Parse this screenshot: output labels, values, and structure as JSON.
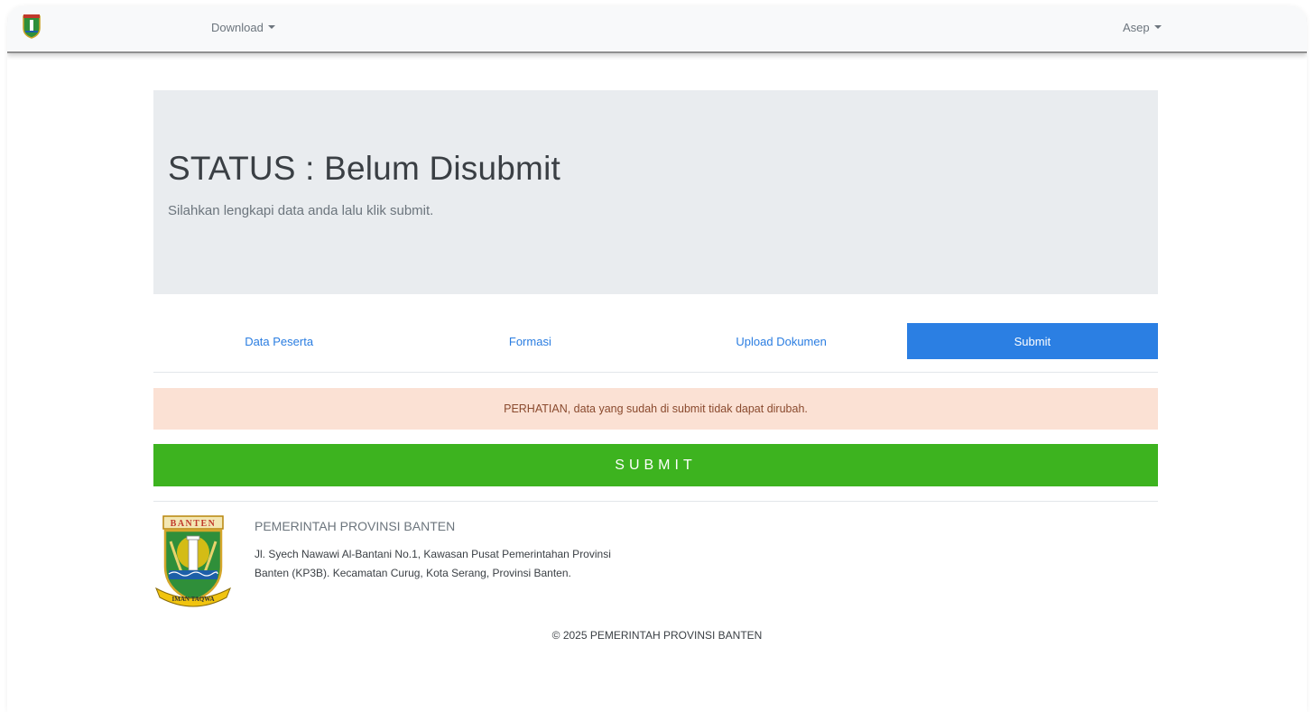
{
  "navbar": {
    "download_label": "Download",
    "user_label": "Asep"
  },
  "status": {
    "title": "STATUS : Belum Disubmit",
    "subtitle": "Silahkan lengkapi data anda lalu klik submit."
  },
  "tabs": [
    {
      "label": "Data Peserta",
      "active": false
    },
    {
      "label": "Formasi",
      "active": false
    },
    {
      "label": "Upload Dokumen",
      "active": false
    },
    {
      "label": "Submit",
      "active": true
    }
  ],
  "alert": {
    "text": "PERHATIAN, data yang sudah di submit tidak dapat dirubah."
  },
  "submit_button": {
    "label": "SUBMIT"
  },
  "footer": {
    "logo_banner_text": "BANTEN",
    "logo_ribbon_text": "IMAN TAQWA",
    "org_name": "PEMERINTAH PROVINSI BANTEN",
    "address": "Jl. Syech Nawawi Al-Bantani No.1, Kawasan Pusat Pemerintahan Provinsi Banten (KP3B). Kecamatan Curug, Kota Serang, Provinsi Banten.",
    "copyright": "© 2025 PEMERINTAH PROVINSI BANTEN"
  },
  "colors": {
    "primary": "#2b7fe3",
    "success": "#3db31f",
    "alert_bg": "#fbe1d4",
    "jumbotron_bg": "#e9ecef"
  },
  "icons": {
    "nav_logo": "banten-emblem-icon",
    "dropdown_caret": "caret-down-icon"
  }
}
